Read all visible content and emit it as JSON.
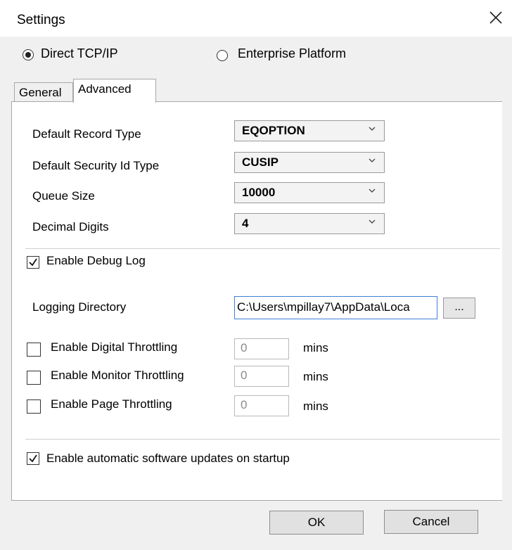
{
  "window": {
    "title": "Settings",
    "close_icon": "close-icon"
  },
  "connection": {
    "options": [
      {
        "label": "Direct TCP/IP",
        "selected": true
      },
      {
        "label": "Enterprise Platform",
        "selected": false
      }
    ]
  },
  "tabs": [
    {
      "label": "General",
      "active": false
    },
    {
      "label": "Advanced",
      "active": true
    }
  ],
  "advanced": {
    "default_record_type": {
      "label": "Default Record Type",
      "value": "EQOPTION"
    },
    "default_security_id_type": {
      "label": "Default Security Id Type",
      "value": "CUSIP"
    },
    "queue_size": {
      "label": "Queue Size",
      "value": "10000"
    },
    "decimal_digits": {
      "label": "Decimal Digits",
      "value": "4"
    },
    "enable_debug_log": {
      "label": "Enable Debug Log",
      "checked": true
    },
    "logging_directory": {
      "label": "Logging Directory",
      "value": "C:\\Users\\mpillay7\\AppData\\Loca",
      "browse_label": "..."
    },
    "throttling": [
      {
        "label": "Enable Digital Throttling",
        "checked": false,
        "placeholder": "0",
        "unit": "mins"
      },
      {
        "label": "Enable Monitor Throttling",
        "checked": false,
        "placeholder": "0",
        "unit": "mins"
      },
      {
        "label": "Enable Page Throttling",
        "checked": false,
        "placeholder": "0",
        "unit": "mins"
      }
    ],
    "auto_updates": {
      "label": "Enable automatic software updates on startup",
      "checked": true
    }
  },
  "footer": {
    "ok_label": "OK",
    "cancel_label": "Cancel"
  }
}
